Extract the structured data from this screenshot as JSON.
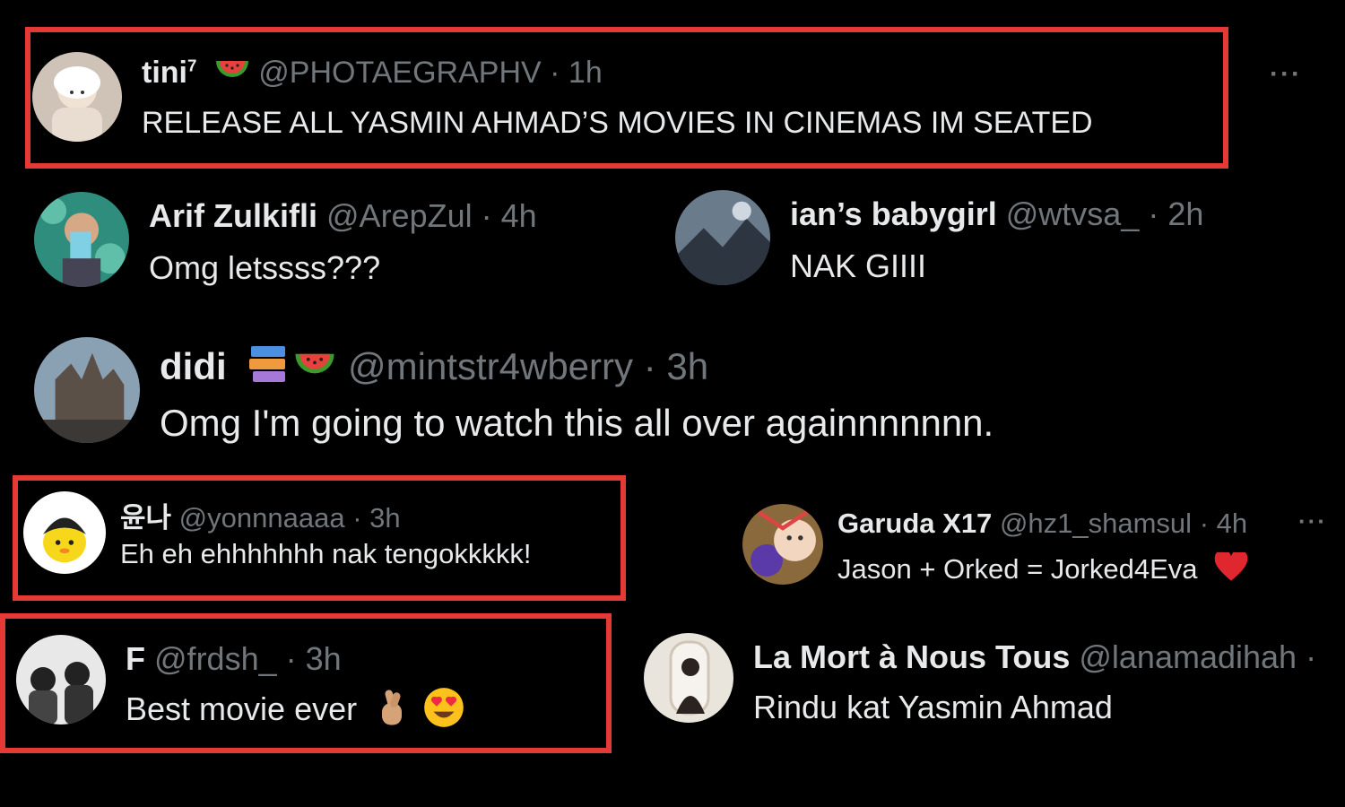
{
  "tweets": {
    "t1": {
      "name": "tini",
      "sup": "7",
      "handle": "@PHOTAEGRAPHV",
      "dot": "·",
      "time": "1h",
      "text": "RELEASE ALL YASMIN AHMAD’S MOVIES IN CINEMAS IM SEATED",
      "more": "···"
    },
    "t2": {
      "name": "Arif Zulkifli",
      "handle": "@ArepZul",
      "dot": "·",
      "time": "4h",
      "text": "Omg letssss???"
    },
    "t3": {
      "name": "ian’s babygirl",
      "handle": "@wtvsa_",
      "dot": "·",
      "time": "2h",
      "text": "NAK GIIII"
    },
    "t4": {
      "name": "didi",
      "handle": "@mintstr4wberry",
      "dot": "·",
      "time": "3h",
      "text": "Omg I'm going to watch this all over againnnnnnn."
    },
    "t5": {
      "name": "윤나",
      "handle": "@yonnnaaaa",
      "dot": "·",
      "time": "3h",
      "text": "Eh eh ehhhhhhh nak tengokkkkk!"
    },
    "t6": {
      "name": "Garuda X17",
      "handle": "@hz1_shamsul",
      "dot": "·",
      "time": "4h",
      "text": "Jason + Orked = Jorked4Eva",
      "more": "···"
    },
    "t7": {
      "name": "F",
      "handle": "@frdsh_",
      "dot": "·",
      "time": "3h",
      "text": "Best movie ever"
    },
    "t8": {
      "name": "La Mort à Nous Tous",
      "handle": "@lanamadihah",
      "dot": "·",
      "time": "",
      " text_alt": "",
      "text": "Rindu kat Yasmin Ahmad"
    }
  },
  "colors": {
    "highlight": "#e53935",
    "background": "#000000",
    "muted": "#71767b",
    "text": "#e7e9ea"
  },
  "icons": [
    "watermelon-icon",
    "books-icon",
    "heart-icon",
    "finger-heart-icon",
    "heart-eyes-icon",
    "more-icon"
  ]
}
